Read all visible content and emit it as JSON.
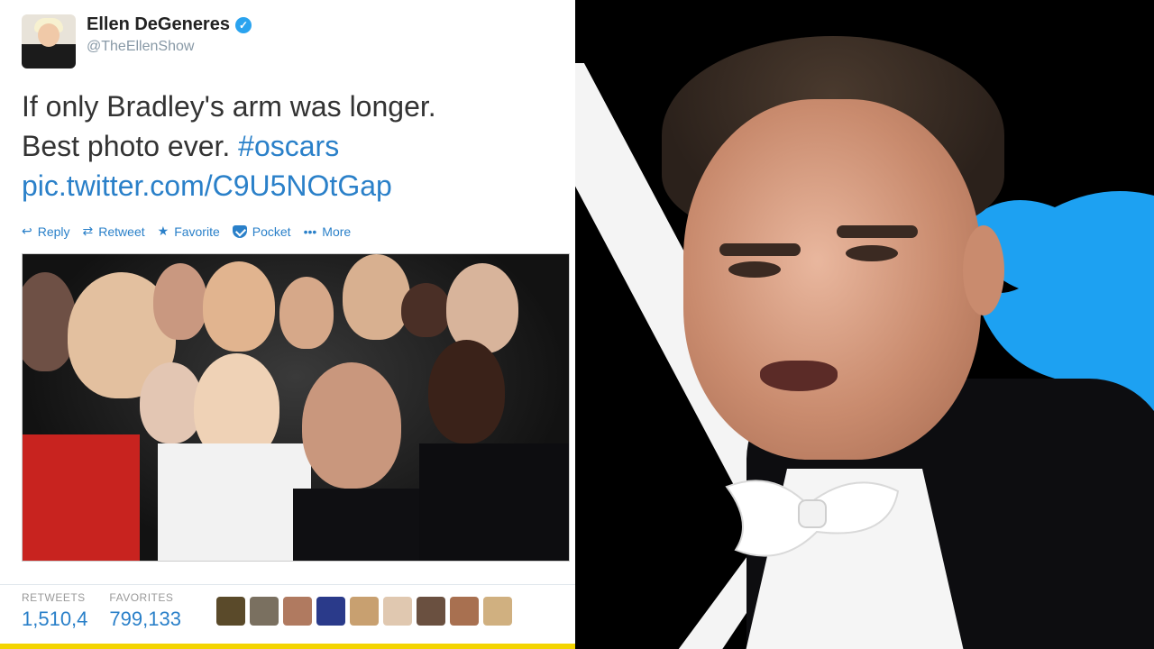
{
  "tweet": {
    "display_name": "Ellen DeGeneres",
    "handle": "@TheEllenShow",
    "text_line1": "If only Bradley's arm was longer.",
    "text_line2_prefix": "Best photo ever. ",
    "hashtag": "#oscars",
    "link": "pic.twitter.com/C9U5NOtGap",
    "actions": {
      "reply": "Reply",
      "retweet": "Retweet",
      "favorite": "Favorite",
      "pocket": "Pocket",
      "more": "More"
    },
    "stats": {
      "retweets_label": "RETWEETS",
      "retweets_value": "1,510,4",
      "favorites_label": "FAVORITES",
      "favorites_value": "799,133"
    }
  },
  "colors": {
    "link_blue": "#2a80c9",
    "verified_blue": "#2aa3ef",
    "accent_yellow": "#f3d400",
    "bird_blue": "#1da1f2"
  },
  "icons": {
    "reply": "reply-icon",
    "retweet": "retweet-icon",
    "favorite": "star-icon",
    "pocket": "pocket-icon",
    "more": "more-dots-icon",
    "verified": "verified-badge-icon",
    "x_logo": "x-logo-icon",
    "bird": "twitter-bird-icon"
  }
}
